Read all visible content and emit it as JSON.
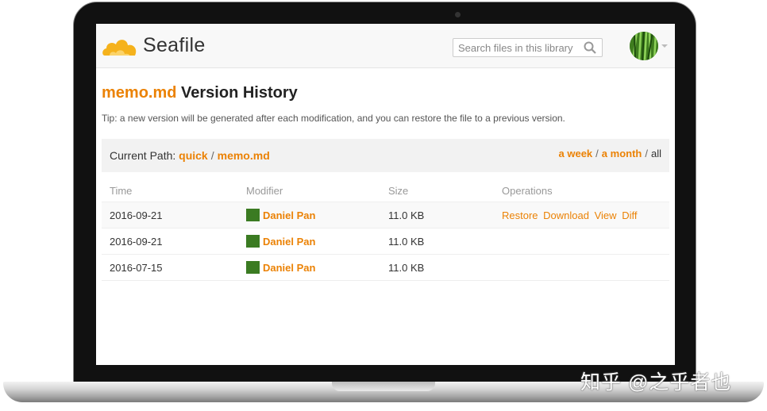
{
  "header": {
    "logo_text": "Seafile",
    "search_placeholder": "Search files in this library"
  },
  "page": {
    "title_file": "memo.md",
    "title_rest": " Version History",
    "tip": "Tip: a new version will be generated after each modification, and you can restore the file to a previous version."
  },
  "path": {
    "label": "Current Path:",
    "parts": [
      "quick",
      "memo.md"
    ],
    "separator": "/"
  },
  "filters": {
    "items": [
      "a week",
      "a month",
      "all"
    ],
    "separator": "/"
  },
  "table": {
    "headers": [
      "Time",
      "Modifier",
      "Size",
      "Operations"
    ],
    "rows": [
      {
        "time": "2016-09-21",
        "modifier": "Daniel Pan",
        "size": "11.0 KB",
        "ops": [
          "Restore",
          "Download",
          "View",
          "Diff"
        ]
      },
      {
        "time": "2016-09-21",
        "modifier": "Daniel Pan",
        "size": "11.0 KB",
        "ops": []
      },
      {
        "time": "2016-07-15",
        "modifier": "Daniel Pan",
        "size": "11.0 KB",
        "ops": []
      }
    ]
  },
  "watermark": "知乎 @之乎者也",
  "colors": {
    "accent": "#eb8205",
    "logo": "#f5b21c"
  }
}
